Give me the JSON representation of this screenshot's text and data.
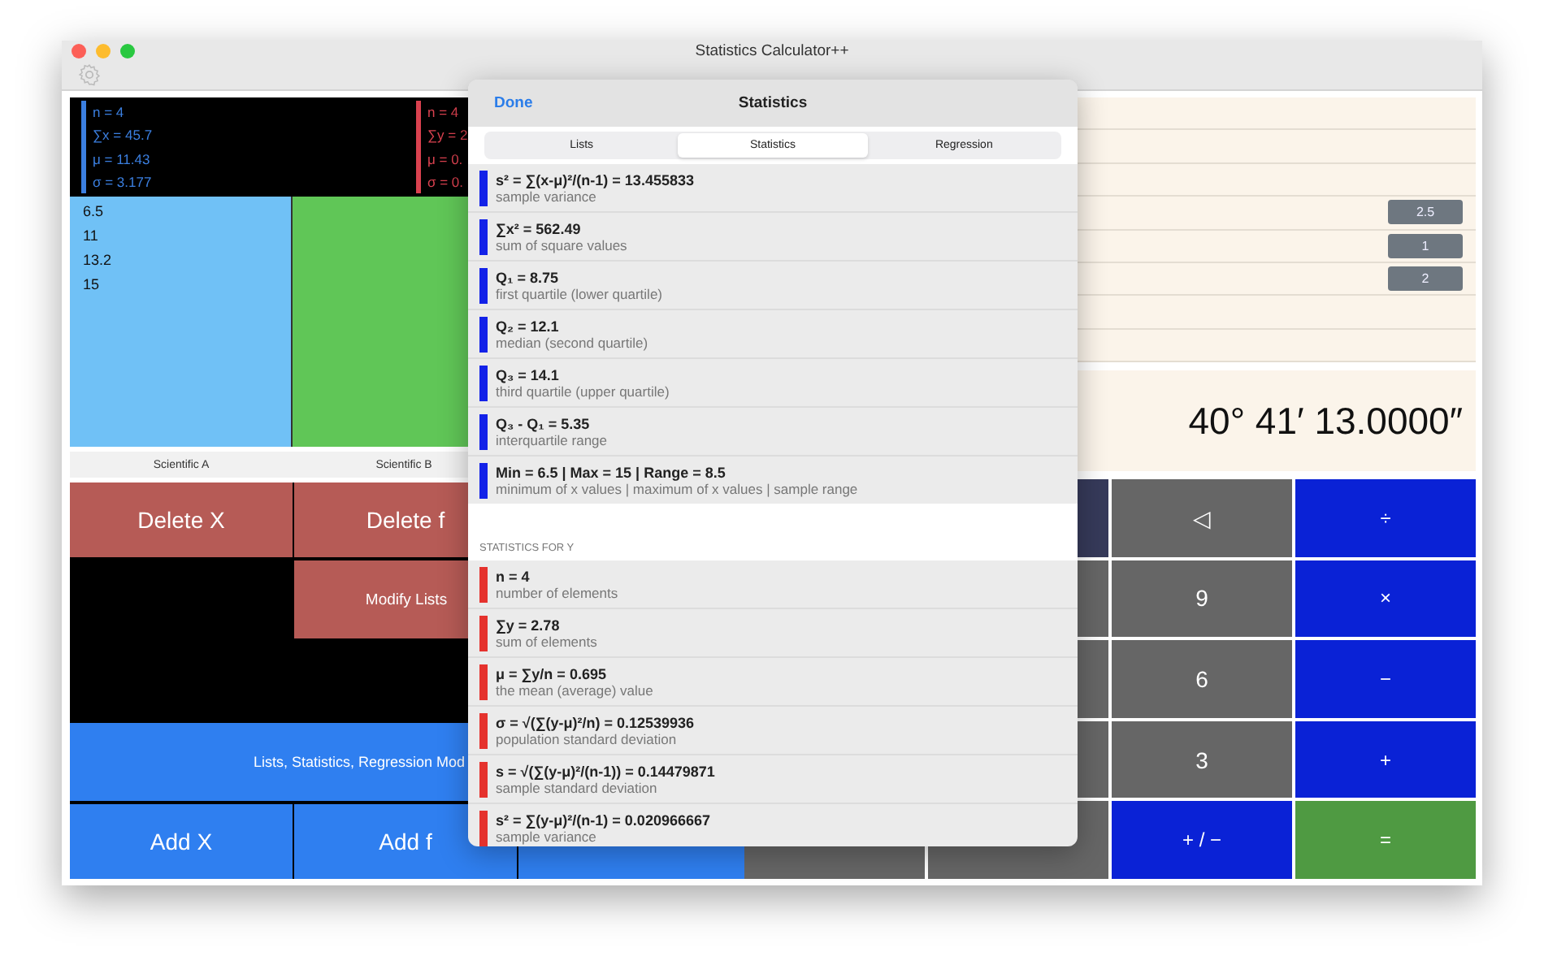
{
  "window": {
    "title": "Statistics Calculator++"
  },
  "x_summary": {
    "color": "#3b7fe0",
    "lines": [
      "n = 4",
      "∑x = 45.7",
      "μ = 11.43",
      "σ = 3.177"
    ]
  },
  "y_summary": {
    "color": "#d9414f",
    "lines": [
      "n = 4",
      "∑y = 2",
      "μ = 0.",
      "σ = 0."
    ]
  },
  "list_columns": [
    {
      "color": "#70c1f6",
      "values": [
        "6.5",
        "11",
        "13.2",
        "15"
      ]
    },
    {
      "color": "#60c657"
    }
  ],
  "mode_tabs": [
    {
      "label": "Scientific A"
    },
    {
      "label": "Scientific B"
    }
  ],
  "list_buttons": [
    {
      "label": "Delete X",
      "kind": "delete"
    },
    {
      "label": "Delete f",
      "kind": "delete"
    },
    {
      "kind": "spacer"
    },
    {
      "label": "Modify Lists",
      "kind": "modify"
    },
    {
      "label": "Lists, Statistics, Regression Mod",
      "kind": "wide"
    },
    {
      "label": "Add X",
      "kind": "add"
    },
    {
      "label": "Add f",
      "kind": "add"
    },
    {
      "kind": "add"
    }
  ],
  "memory_rows": [
    {},
    {},
    {},
    {
      "badge": "2.5"
    },
    {
      "badge": "1"
    },
    {
      "badge": "2"
    },
    {},
    {}
  ],
  "display": "40° 41′ 13.0000″",
  "key_rows": [
    [
      {
        "kind": "dark"
      },
      {
        "kind": "digit",
        "label": "◁"
      },
      {
        "kind": "operator",
        "label": "÷"
      }
    ],
    [
      {
        "kind": "digit"
      },
      {
        "kind": "digit",
        "label": "9"
      },
      {
        "kind": "operator",
        "label": "×"
      }
    ],
    [
      {
        "kind": "digit"
      },
      {
        "kind": "digit",
        "label": "6"
      },
      {
        "kind": "operator",
        "label": "−"
      }
    ],
    [
      {
        "kind": "digit"
      },
      {
        "kind": "digit",
        "label": "3"
      },
      {
        "kind": "operator",
        "label": "+"
      }
    ],
    [
      {
        "kind": "digit"
      },
      {
        "kind": "digit"
      },
      {
        "kind": "operator",
        "label": "+ / −"
      },
      {
        "kind": "equals",
        "label": "="
      }
    ]
  ],
  "popover": {
    "done": "Done",
    "title": "Statistics",
    "tabs": [
      {
        "label": "Lists",
        "selected": false
      },
      {
        "label": "Statistics",
        "selected": true
      },
      {
        "label": "Regression",
        "selected": false
      }
    ],
    "sections": [
      {
        "color": "#1322e8",
        "items": [
          {
            "formula": "s² = ∑(x-μ)²/(n-1) = 13.455833",
            "caption": "sample variance"
          },
          {
            "formula": "∑x² = 562.49",
            "caption": "sum of square values"
          },
          {
            "formula": "Q₁ = 8.75",
            "caption": "first quartile (lower quartile)"
          },
          {
            "formula": "Q₂ = 12.1",
            "caption": "median (second quartile)"
          },
          {
            "formula": "Q₃ = 14.1",
            "caption": "third quartile (upper quartile)"
          },
          {
            "formula": "Q₃ - Q₁ = 5.35",
            "caption": "interquartile range"
          },
          {
            "formula": "Min = 6.5 | Max = 15 | Range = 8.5",
            "caption": "minimum of x values | maximum of x values | sample range"
          }
        ]
      },
      {
        "header": "STATISTICS FOR Y",
        "color": "#e5322d",
        "items": [
          {
            "formula": "n = 4",
            "caption": "number of elements"
          },
          {
            "formula": "∑y = 2.78",
            "caption": "sum of elements"
          },
          {
            "formula": "μ = ∑y/n = 0.695",
            "caption": "the mean (average) value"
          },
          {
            "formula": "σ = √(∑(y-μ)²/n) =  0.12539936",
            "caption": "population standard deviation"
          },
          {
            "formula": "s = √(∑(y-μ)²/(n-1)) = 0.14479871",
            "caption": "sample standard deviation"
          },
          {
            "formula": "s² = ∑(y-μ)²/(n-1) = 0.020966667",
            "caption": "sample variance"
          }
        ]
      }
    ]
  }
}
